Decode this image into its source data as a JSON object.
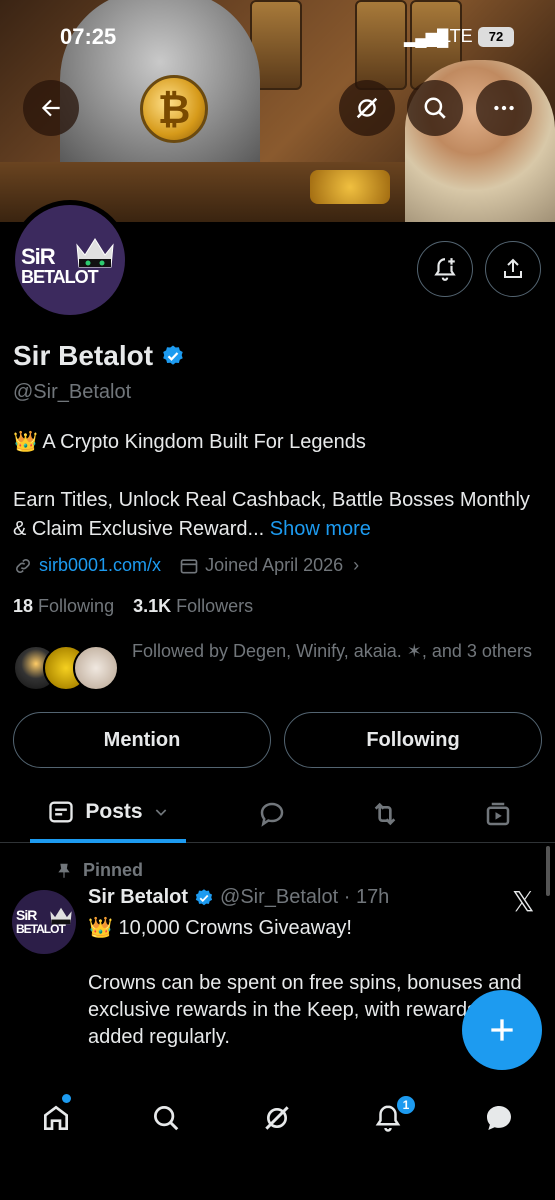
{
  "status_bar": {
    "time": "07:25",
    "network": "LTE",
    "battery": "72"
  },
  "profile": {
    "name": "Sir Betalot",
    "handle": "@Sir_Betalot",
    "logo_line1": "SiR",
    "logo_line2": "BETALOT",
    "bio_line1": "👑 A Crypto Kingdom Built For Legends",
    "bio_line2": "Earn Titles, Unlock Real Cashback, Battle Bosses Monthly & Claim Exclusive Reward...",
    "show_more": "Show more",
    "link": "sirb0001.com/x",
    "joined": "Joined April 2026",
    "following_count": "18",
    "following_label": "Following",
    "followers_count": "3.1K",
    "followers_label": "Followers",
    "followed_by": "Followed by Degen, Winify, akaia. ✶, and 3 others"
  },
  "actions": {
    "mention": "Mention",
    "following": "Following"
  },
  "tabs": {
    "posts": "Posts"
  },
  "post": {
    "pinned_label": "Pinned",
    "author": "Sir Betalot",
    "handle_time": "@Sir_Betalot · 17h",
    "line1": "👑 10,000 Crowns Giveaway!",
    "line2": "Crowns can be spent on free spins, bonuses and exclusive rewards in the Keep, with rewards added regularly."
  },
  "nav": {
    "notifications_badge": "1"
  },
  "colors": {
    "accent": "#1d9bf0",
    "background": "#000000",
    "muted": "#71767b",
    "avatar_bg": "#3c2a5e"
  }
}
